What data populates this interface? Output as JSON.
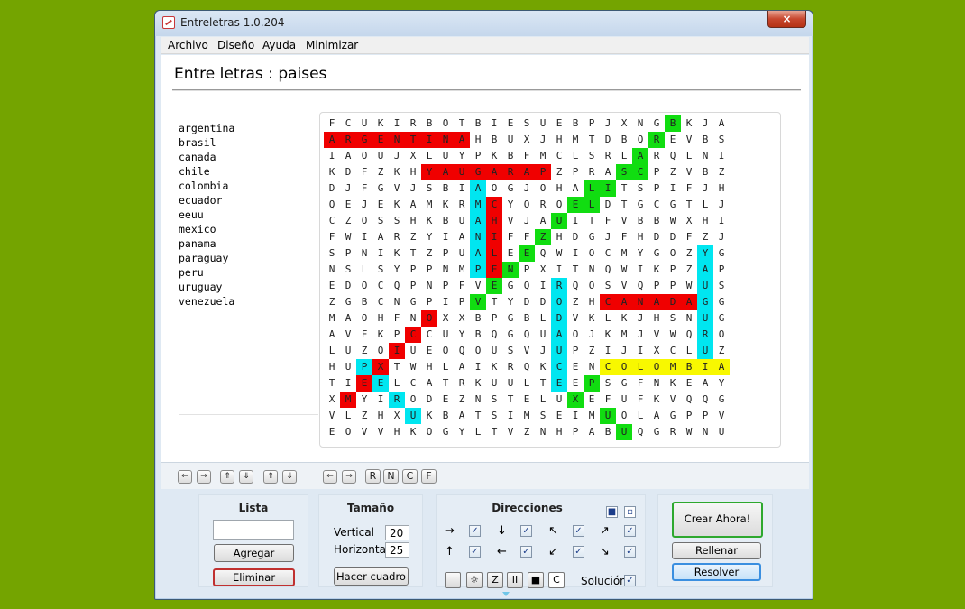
{
  "window": {
    "title": "Entreletras 1.0.204",
    "close_label": "×"
  },
  "menu": [
    "Archivo",
    "Diseño",
    "Ayuda",
    "Minimizar"
  ],
  "page_title_prefix": "Entre letras :",
  "page_title_topic": "paises",
  "words": [
    "argentina",
    "brasil",
    "canada",
    "chile",
    "colombia",
    "ecuador",
    "eeuu",
    "mexico",
    "panama",
    "paraguay",
    "peru",
    "uruguay",
    "venezuela"
  ],
  "grid": [
    "FCUKIRBOTBIESUEBPJXNGBKJA",
    "ARGENTINAHBUXJHMTDBQREVBS",
    "IAOUJXLUYPKBFMCLSRLARQLNI",
    "KDFZKHYAUGARAPZPRASCPZVBZ",
    "DJFGVJSBIAOGJOHALITSPIFJH",
    "QEJEKAMKRMCYORQELDTGCGTLJ",
    "CZOSSHKBUAHVJAUITFVBBWXHI",
    "FWIARZYIANIFFZHDGJFHDDFZJ",
    "SPNIKTZPUALEEQWIOCMYGOZYG",
    "NSLSYPPNMPENPXITNQWIKPZAP",
    "EDOCQPNPFVEGQIRQOSVQPPWUS",
    "ZGBCNGPIPVTYDDOZHCANADAGG",
    "MAOHFNOXXBPGBLDVKLKJHSNUG",
    "AVFKPCCUYBQGQUAOJKMJVWQRO",
    "LUZOIUEOQOUSVJUPZIJIXCLUZ",
    "HUPXTWHLAIKRQKCENCOLOMBIA",
    "TIEELCATRKUULTEEPSGFNKEAY",
    "XMYIRODEZNSTELUXEFUFKVQQG",
    "VLZHXUKBATSIMSEIMUOLAGPPV",
    "EOVVHKOGYLTVZNHPABUQGRWNU"
  ],
  "highlights": {
    "red": [
      [
        1,
        0
      ],
      [
        1,
        1
      ],
      [
        1,
        2
      ],
      [
        1,
        3
      ],
      [
        1,
        4
      ],
      [
        1,
        5
      ],
      [
        1,
        6
      ],
      [
        1,
        7
      ],
      [
        1,
        8
      ],
      [
        3,
        6
      ],
      [
        3,
        7
      ],
      [
        3,
        8
      ],
      [
        3,
        9
      ],
      [
        3,
        10
      ],
      [
        3,
        11
      ],
      [
        3,
        12
      ],
      [
        3,
        13
      ],
      [
        5,
        10
      ],
      [
        6,
        10
      ],
      [
        7,
        10
      ],
      [
        8,
        10
      ],
      [
        9,
        10
      ],
      [
        11,
        17
      ],
      [
        11,
        18
      ],
      [
        11,
        19
      ],
      [
        11,
        20
      ],
      [
        11,
        21
      ],
      [
        11,
        22
      ],
      [
        12,
        6
      ],
      [
        13,
        5
      ],
      [
        14,
        4
      ],
      [
        15,
        3
      ],
      [
        16,
        2
      ],
      [
        17,
        1
      ]
    ],
    "green": [
      [
        0,
        21
      ],
      [
        1,
        20
      ],
      [
        2,
        19
      ],
      [
        3,
        18
      ],
      [
        3,
        19
      ],
      [
        4,
        16
      ],
      [
        4,
        17
      ],
      [
        5,
        15
      ],
      [
        5,
        16
      ],
      [
        6,
        14
      ],
      [
        7,
        13
      ],
      [
        8,
        12
      ],
      [
        9,
        11
      ],
      [
        10,
        10
      ],
      [
        11,
        9
      ],
      [
        16,
        16
      ],
      [
        17,
        15
      ],
      [
        18,
        17
      ],
      [
        19,
        18
      ]
    ],
    "cyan": [
      [
        4,
        9
      ],
      [
        5,
        9
      ],
      [
        6,
        9
      ],
      [
        7,
        9
      ],
      [
        8,
        9
      ],
      [
        9,
        9
      ],
      [
        8,
        23
      ],
      [
        9,
        23
      ],
      [
        10,
        23
      ],
      [
        11,
        23
      ],
      [
        12,
        23
      ],
      [
        13,
        23
      ],
      [
        14,
        23
      ],
      [
        10,
        14
      ],
      [
        11,
        14
      ],
      [
        12,
        14
      ],
      [
        13,
        14
      ],
      [
        14,
        14
      ],
      [
        15,
        14
      ],
      [
        16,
        14
      ],
      [
        15,
        2
      ],
      [
        16,
        3
      ],
      [
        17,
        4
      ],
      [
        18,
        5
      ]
    ],
    "yellow": [
      [
        15,
        17
      ],
      [
        15,
        18
      ],
      [
        15,
        19
      ],
      [
        15,
        20
      ],
      [
        15,
        21
      ],
      [
        15,
        22
      ],
      [
        15,
        23
      ],
      [
        15,
        24
      ]
    ]
  },
  "colors": {
    "red": "#f00000",
    "green": "#11dd11",
    "cyan": "#00e6f0",
    "yellow": "#f8f800",
    "desktop": "#74a400"
  },
  "toolbar": {
    "icons": [
      "move-left-icon",
      "move-right-icon",
      "move-up-icon",
      "move-down-icon",
      "move-up-alt-icon",
      "move-down-alt-icon",
      "prev-icon",
      "next-icon"
    ],
    "letters": [
      "R",
      "N",
      "C",
      "F"
    ]
  },
  "lista": {
    "title": "Lista",
    "input_value": "",
    "add_label": "Agregar",
    "remove_label": "Eliminar"
  },
  "tamano": {
    "title": "Tamaño",
    "vertical_label": "Vertical",
    "vertical_value": "20",
    "horizontal_label": "Horizontal",
    "horizontal_value": "25",
    "make_label": "Hacer cuadro"
  },
  "direcciones": {
    "title": "Direcciones",
    "arrows": [
      "→",
      "↓",
      "↖",
      "↗",
      "↑",
      "←",
      "↙",
      "↘"
    ],
    "mode_buttons": [
      "",
      "☼",
      "Z",
      "II",
      "■",
      "C"
    ],
    "solution_label": "Solución"
  },
  "actions": {
    "create_label": "Crear Ahora!",
    "fill_label": "Rellenar",
    "solve_label": "Resolver"
  }
}
